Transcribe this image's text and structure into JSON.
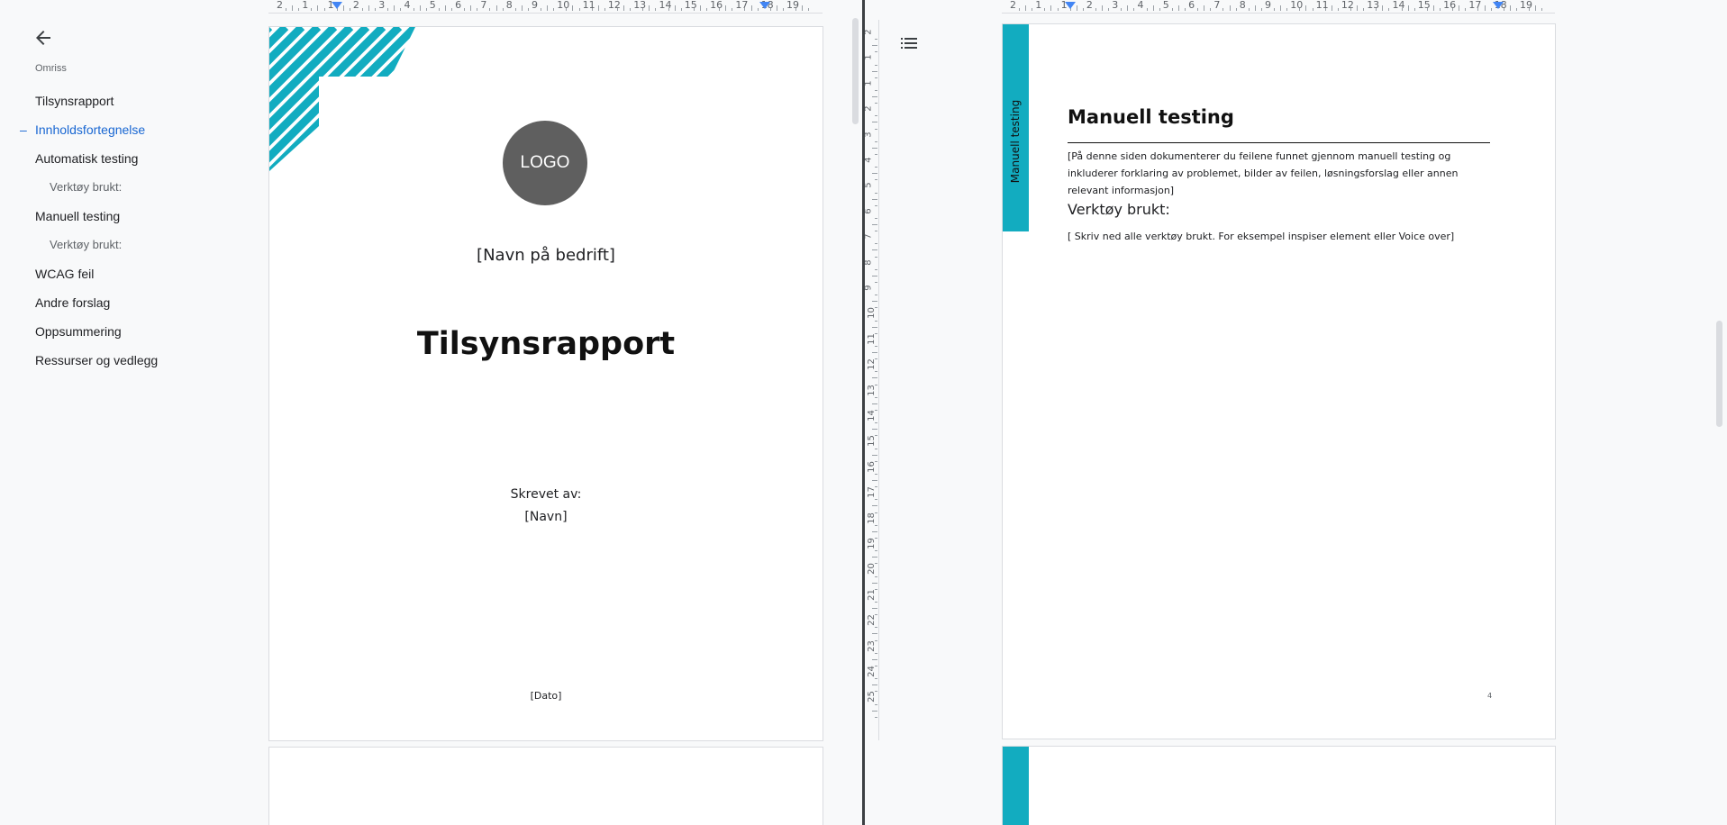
{
  "colors": {
    "accent": "#12acc0",
    "logo_bg": "#5f5f5f",
    "active_outline": "#1967d2"
  },
  "outline": {
    "back_icon": "arrow-left-icon",
    "title": "Omriss",
    "items": [
      {
        "label": "Tilsynsrapport",
        "level": 1,
        "active": false
      },
      {
        "label": "Innholdsfortegnelse",
        "level": 1,
        "active": true
      },
      {
        "label": "Automatisk testing",
        "level": 1,
        "active": false
      },
      {
        "label": "Verktøy brukt:",
        "level": 2,
        "active": false
      },
      {
        "label": "Manuell testing",
        "level": 1,
        "active": false
      },
      {
        "label": "Verktøy brukt:",
        "level": 2,
        "active": false
      },
      {
        "label": "WCAG feil",
        "level": 1,
        "active": false
      },
      {
        "label": "Andre forslag",
        "level": 1,
        "active": false
      },
      {
        "label": "Oppsummering",
        "level": 1,
        "active": false
      },
      {
        "label": "Ressurser og vedlegg",
        "level": 1,
        "active": false
      }
    ],
    "active_marker": "–"
  },
  "right_pane": {
    "outline_icon": "list-icon"
  },
  "ruler": {
    "h_labels": [
      "2",
      "1",
      "1",
      "2",
      "3",
      "4",
      "5",
      "6",
      "7",
      "8",
      "9",
      "10",
      "11",
      "12",
      "13",
      "14",
      "15",
      "16",
      "17",
      "18",
      "19"
    ],
    "v_labels": [
      "2",
      "1",
      "1",
      "2",
      "3",
      "4",
      "5",
      "6",
      "7",
      "8",
      "9",
      "10",
      "11",
      "12",
      "13",
      "14",
      "15",
      "16",
      "17",
      "18",
      "19",
      "20",
      "21",
      "22",
      "23",
      "24",
      "25"
    ]
  },
  "cover_page": {
    "logo": "LOGO",
    "company": "[Navn på bedrift]",
    "title": "Tilsynsrapport",
    "written_by_label": "Skrevet av:",
    "author": "[Navn]",
    "date": "[Dato]"
  },
  "manual_page": {
    "side_tab": "Manuell testing",
    "heading": "Manuell testing",
    "intro": "[På denne siden dokumenterer du feilene funnet gjennom manuell testing og inkluderer forklaring av problemet, bilder av feilen, løsningsforslag eller annen relevant informasjon]",
    "subheading": "Verktøy brukt:",
    "tools_text": "[ Skriv ned alle verktøy brukt. For eksempel inspiser element eller Voice over]",
    "page_number": "4"
  }
}
